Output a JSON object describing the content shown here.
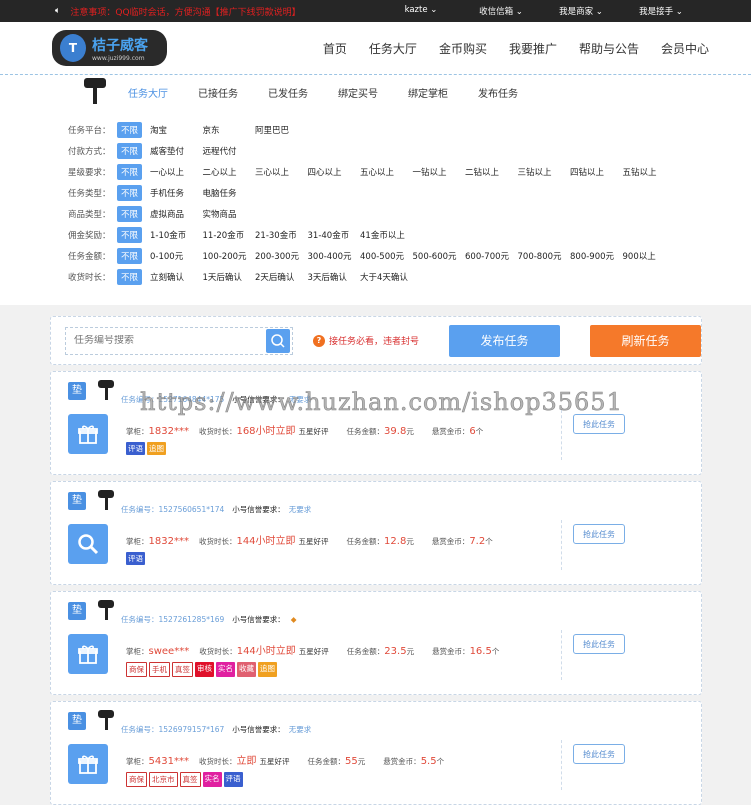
{
  "topbar": {
    "notice": "注意事项：QQ临时会话，方便沟通【推广下线罚款说明】",
    "menus": [
      "kazte ⌄",
      "收信信箱 ⌄",
      "我是商家 ⌄",
      "我是接手 ⌄"
    ]
  },
  "header": {
    "logo_title": "桔子威客",
    "logo_url": "www.juzi999.com",
    "nav": [
      "首页",
      "任务大厅",
      "金币购买",
      "我要推广",
      "帮助与公告",
      "会员中心"
    ]
  },
  "subnav": {
    "tabs": [
      "任务大厅",
      "已接任务",
      "已发任务",
      "绑定买号",
      "绑定掌柜",
      "发布任务"
    ]
  },
  "filters": [
    {
      "label": "任务平台：",
      "all": "不限",
      "options": [
        "淘宝",
        "京东",
        "阿里巴巴"
      ]
    },
    {
      "label": "付款方式：",
      "all": "不限",
      "options": [
        "威客垫付",
        "远程代付"
      ]
    },
    {
      "label": "星级要求：",
      "all": "不限",
      "options": [
        "一心以上",
        "二心以上",
        "三心以上",
        "四心以上",
        "五心以上",
        "一钻以上",
        "二钻以上",
        "三钻以上",
        "四钻以上",
        "五钻以上"
      ]
    },
    {
      "label": "任务类型：",
      "all": "不限",
      "options": [
        "手机任务",
        "电脑任务"
      ]
    },
    {
      "label": "商品类型：",
      "all": "不限",
      "options": [
        "虚拟商品",
        "实物商品"
      ]
    },
    {
      "label": "佣金奖励：",
      "all": "不限",
      "options": [
        "1-10金币",
        "11-20金币",
        "21-30金币",
        "31-40金币",
        "41金币以上"
      ]
    },
    {
      "label": "任务金额：",
      "all": "不限",
      "options": [
        "0-100元",
        "100-200元",
        "200-300元",
        "300-400元",
        "400-500元",
        "500-600元",
        "600-700元",
        "700-800元",
        "800-900元",
        "900以上"
      ]
    },
    {
      "label": "收货时长：",
      "all": "不限",
      "options": [
        "立刻确认",
        "1天后确认",
        "2天后确认",
        "3天后确认",
        "大于4天确认"
      ]
    }
  ],
  "search": {
    "placeholder": "任务编号搜索",
    "warning": "接任务必看，违者封号",
    "publish": "发布任务",
    "refresh": "刷新任务"
  },
  "watermark": "https://www.huzhan.com/ishop35651",
  "labels": {
    "dian": "垫",
    "id": "任务编号：",
    "credit": "小号信誉要求：",
    "shop": "掌柜：",
    "time": "收货时长：",
    "amount": "任务金额：",
    "reward": "悬赏金币：",
    "grab": "抢此任务"
  },
  "colors": {
    "accent": "#5aa0ef",
    "orange": "#f5792a"
  },
  "tasks": [
    {
      "id": "1527164844*175",
      "credit": "无要求",
      "shop": "1832***",
      "time": "168小时立即",
      "review": "五星好评",
      "amount": "39.8",
      "amount_unit": "元",
      "reward": "6",
      "reward_unit": "个",
      "icon": "gift-icon",
      "tags": [
        {
          "t": "评语",
          "c": "#3a5fcf"
        },
        {
          "t": "追图",
          "c": "#f0a020"
        }
      ]
    },
    {
      "id": "1527560651*174",
      "credit": "无要求",
      "shop": "1832***",
      "time": "144小时立即",
      "review": "五星好评",
      "amount": "12.8",
      "amount_unit": "元",
      "reward": "7.2",
      "reward_unit": "个",
      "icon": "search-icon",
      "tags": [
        {
          "t": "评语",
          "c": "#3a5fcf"
        }
      ]
    },
    {
      "id": "1527261285*169",
      "credit": "",
      "shop": "swee***",
      "time": "144小时立即",
      "review": "五星好评",
      "amount": "23.5",
      "amount_unit": "元",
      "reward": "16.5",
      "reward_unit": "个",
      "icon": "gift-icon",
      "tags": [
        {
          "t": "商保",
          "c": "out"
        },
        {
          "t": "手机",
          "c": "out"
        },
        {
          "t": "真签",
          "c": "out"
        },
        {
          "t": "审核",
          "c": "#e0102a"
        },
        {
          "t": "实名",
          "c": "#e020a0"
        },
        {
          "t": "收藏",
          "c": "#e06070"
        },
        {
          "t": "追图",
          "c": "#f0a020"
        }
      ]
    },
    {
      "id": "1526979157*167",
      "credit": "无要求",
      "shop": "5431***",
      "time": "立即",
      "review": "五星好评",
      "amount": "55",
      "amount_unit": "元",
      "reward": "5.5",
      "reward_unit": "个",
      "icon": "gift-icon",
      "tags": [
        {
          "t": "商保",
          "c": "out"
        },
        {
          "t": "北京市",
          "c": "out"
        },
        {
          "t": "真签",
          "c": "out"
        },
        {
          "t": "实名",
          "c": "#e020a0"
        },
        {
          "t": "评语",
          "c": "#3a5fcf"
        }
      ]
    }
  ]
}
